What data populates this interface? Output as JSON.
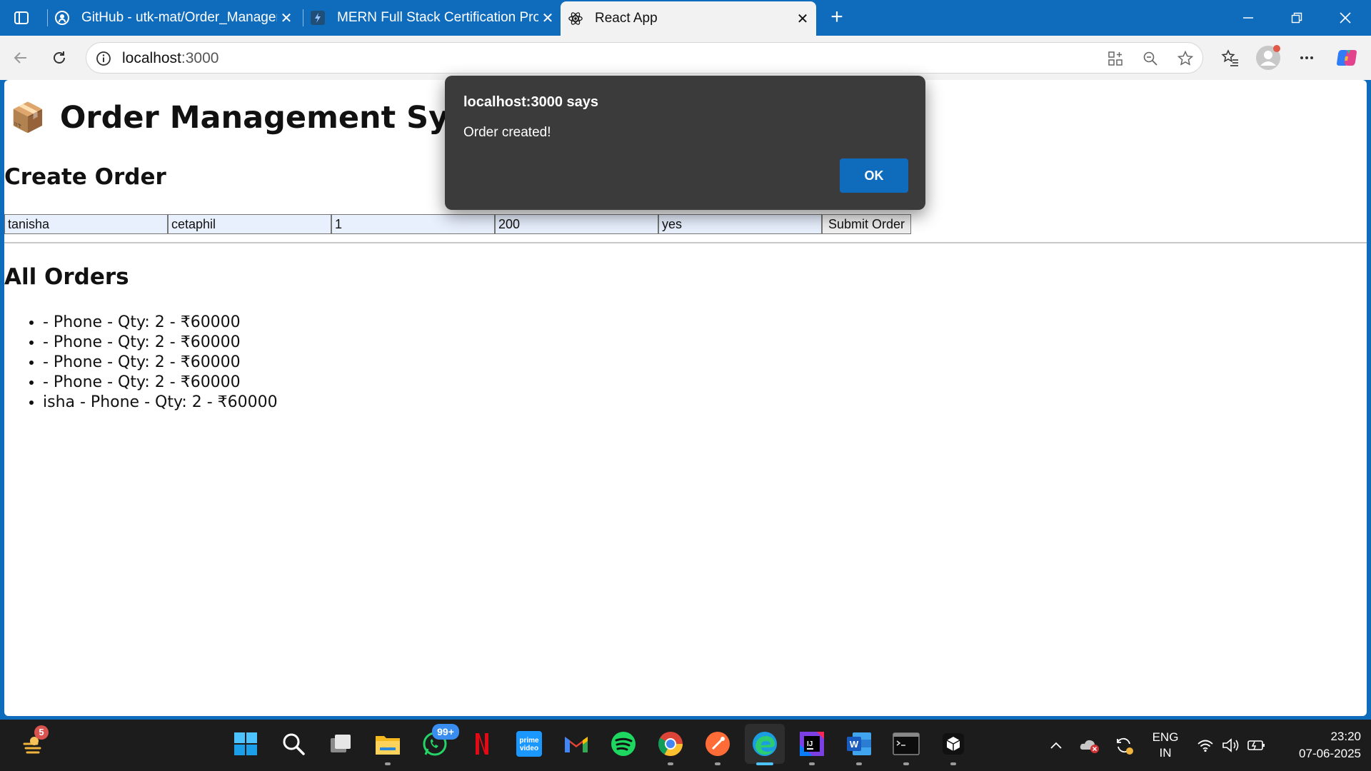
{
  "browser": {
    "tabs": [
      {
        "title": "GitHub - utk-mat/Order_Manager",
        "icon": "github-icon",
        "active": false
      },
      {
        "title": "MERN Full Stack Certification Pro",
        "icon": "course-icon",
        "active": false
      },
      {
        "title": "React App",
        "icon": "react-icon",
        "active": true
      }
    ],
    "new_tab": "+",
    "address": {
      "host": "localhost",
      "port": ":3000"
    }
  },
  "page": {
    "icon": "📦",
    "title": "Order Management System",
    "create_heading": "Create Order",
    "form": {
      "customer": "tanisha",
      "product": "cetaphil",
      "quantity": "1",
      "price": "200",
      "extra": "yes",
      "submit_label": "Submit Order"
    },
    "orders_heading": "All Orders",
    "orders": [
      " - Phone - Qty: 2 - ₹60000",
      " - Phone - Qty: 2 - ₹60000",
      " - Phone - Qty: 2 - ₹60000",
      " - Phone - Qty: 2 - ₹60000",
      "isha - Phone - Qty: 2 - ₹60000"
    ]
  },
  "dialog": {
    "title": "localhost:3000 says",
    "message": "Order created!",
    "ok_label": "OK"
  },
  "taskbar": {
    "widgets_badge": "5",
    "whatsapp_badge": "99+",
    "prime_label": "prime video",
    "lang": {
      "line1": "ENG",
      "line2": "IN"
    },
    "time": "23:20",
    "date": "07-06-2025"
  },
  "colors": {
    "accent": "#0f6cbd",
    "dialog_bg": "#3b3b3b",
    "input_bg": "#e8f0fe"
  }
}
